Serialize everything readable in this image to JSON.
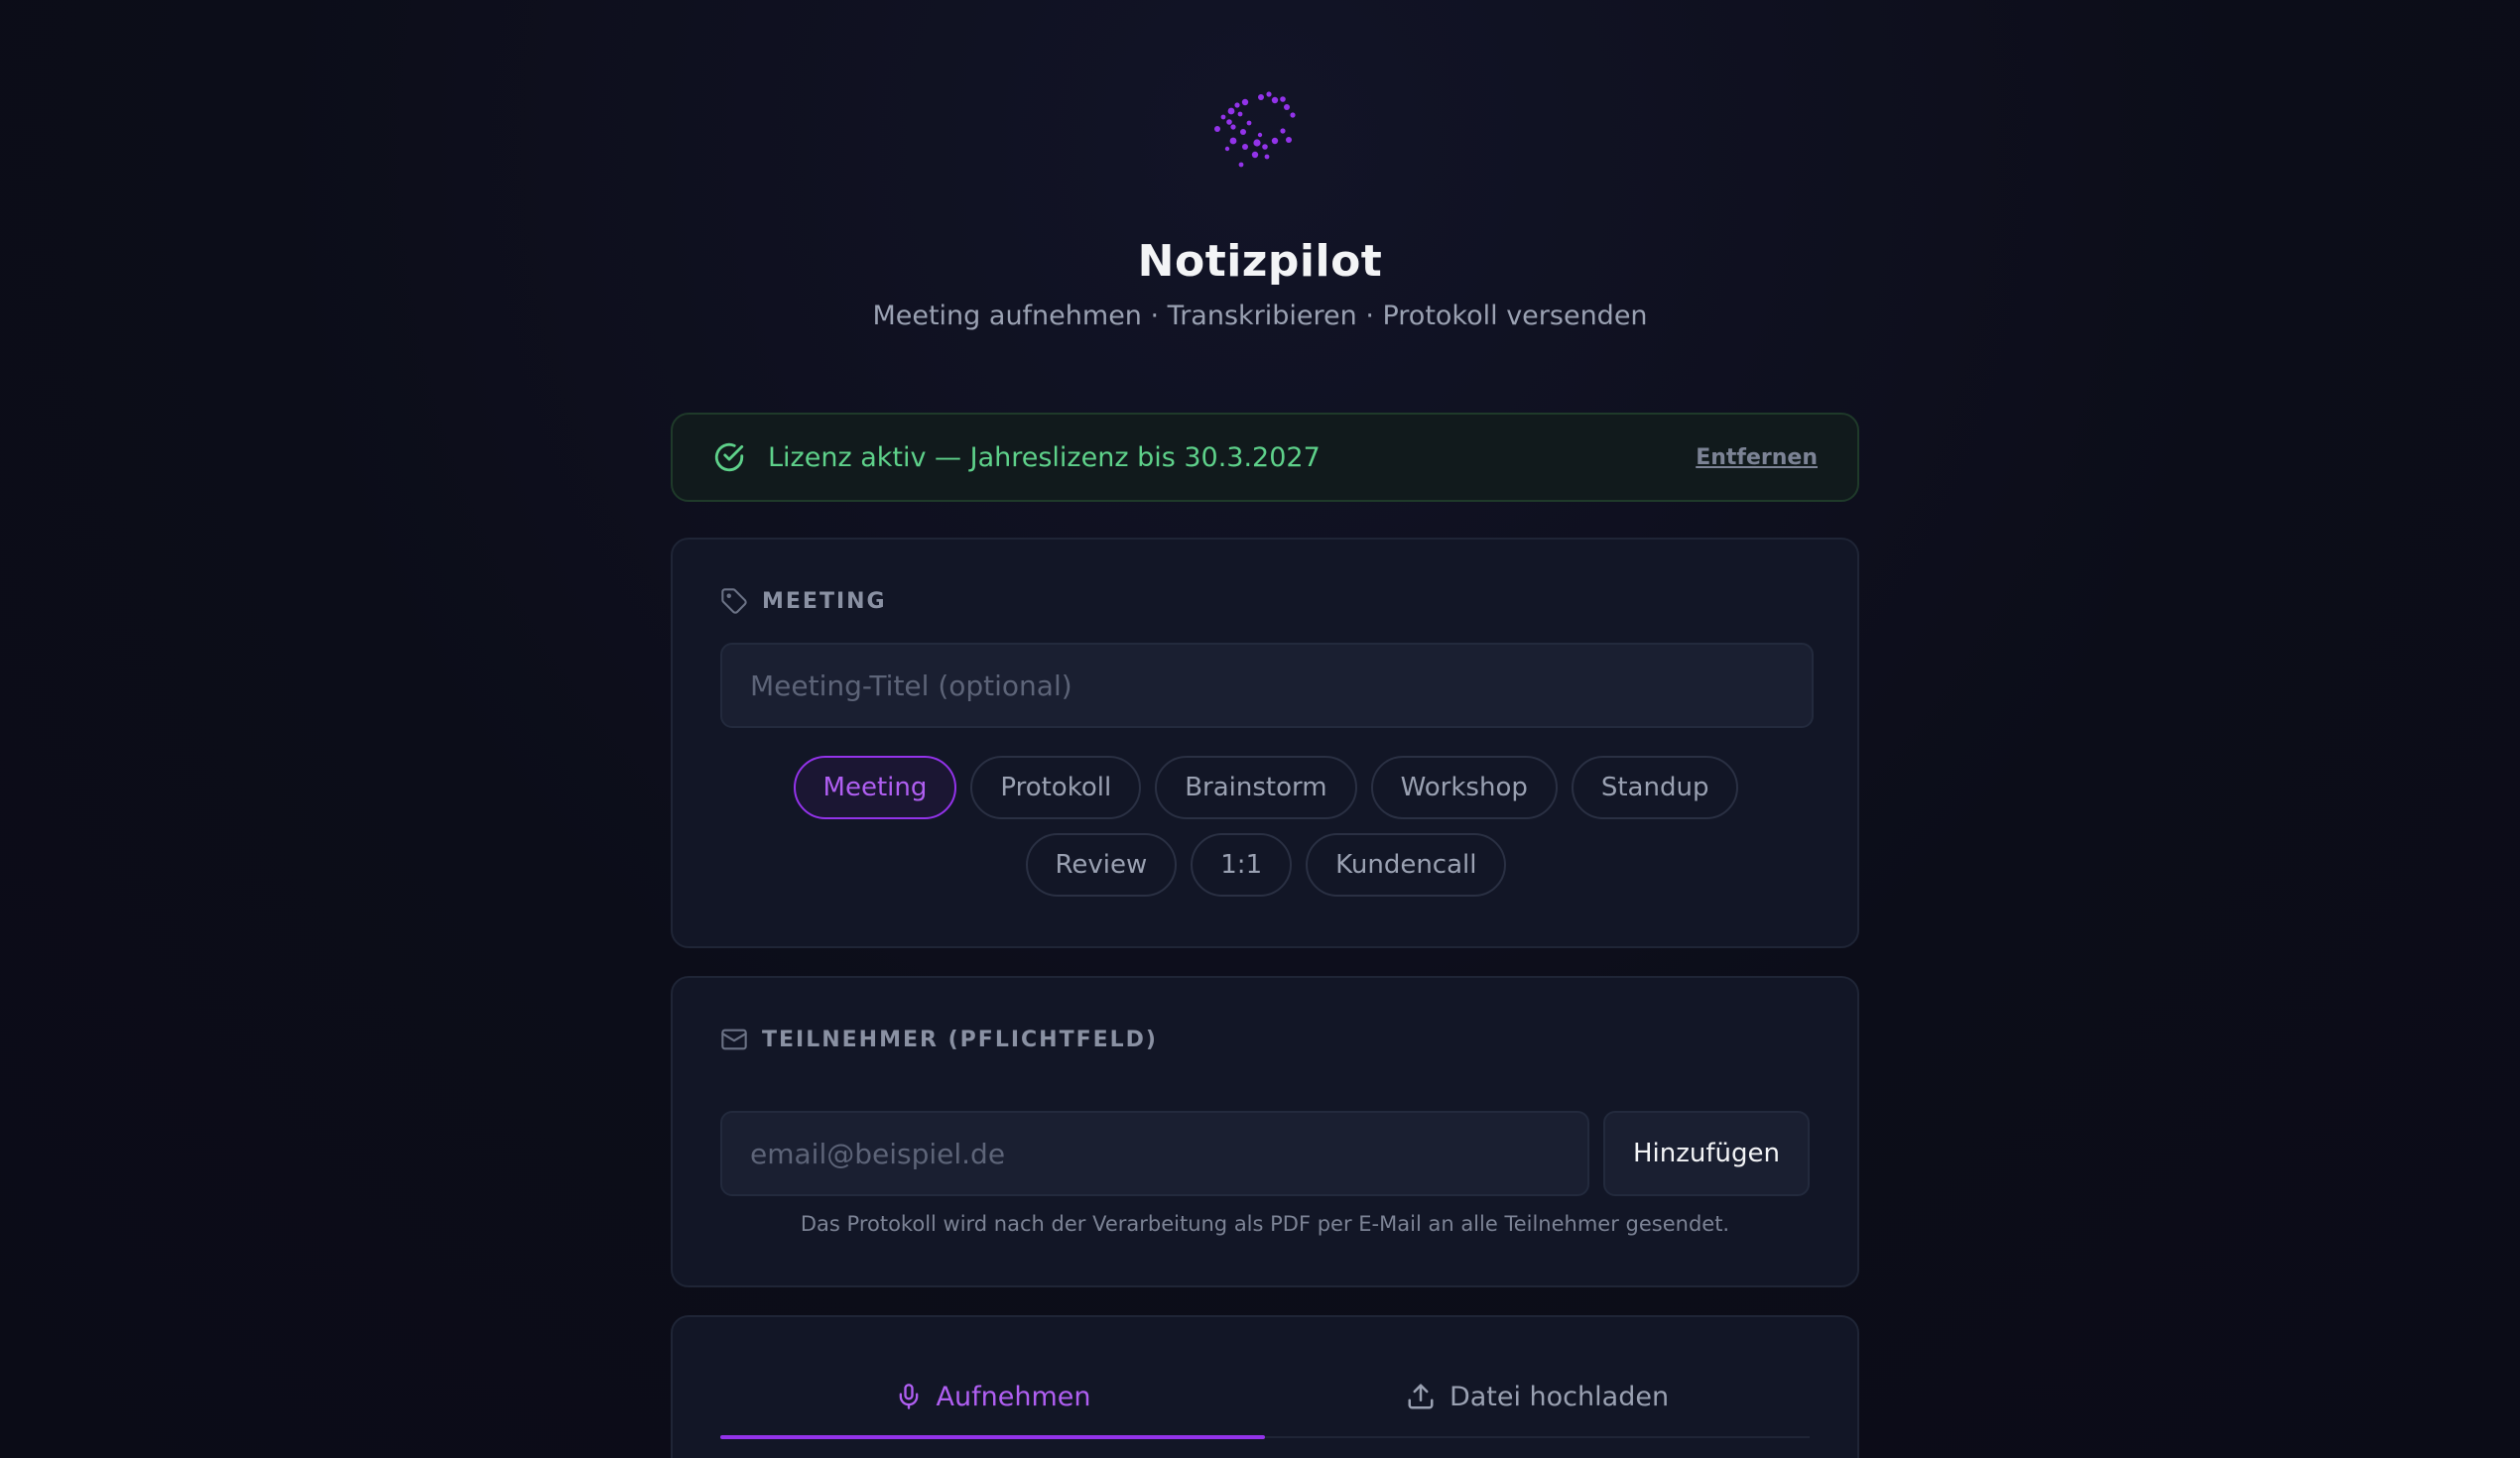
{
  "app": {
    "title": "Notizpilot",
    "subtitle": "Meeting aufnehmen · Transkribieren · Protokoll versenden"
  },
  "license": {
    "status_text": "Lizenz aktiv — Jahreslizenz bis 30.3.2027",
    "remove_label": "Entfernen"
  },
  "meeting": {
    "section_label": "MEETING",
    "title_placeholder": "Meeting-Titel (optional)",
    "tags": [
      "Meeting",
      "Protokoll",
      "Brainstorm",
      "Workshop",
      "Standup",
      "Review",
      "1:1",
      "Kundencall"
    ],
    "selected_tag": "Meeting"
  },
  "participants": {
    "section_label": "TEILNEHMER (PFLICHTFELD)",
    "email_placeholder": "email@beispiel.de",
    "add_label": "Hinzufügen",
    "hint": "Das Protokoll wird nach der Verarbeitung als PDF per E-Mail an alle Teilnehmer gesendet."
  },
  "input_mode": {
    "tabs": [
      "Aufnehmen",
      "Datei hochladen"
    ],
    "active_tab": "Aufnehmen"
  },
  "colors": {
    "accent": "#9333ea",
    "success": "#5ed18a",
    "background": "#0c0d19"
  }
}
